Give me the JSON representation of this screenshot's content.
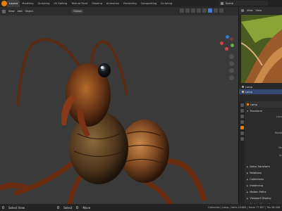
{
  "topbar": {
    "tabs": [
      "Layout",
      "Modeling",
      "Sculpting",
      "UV Editing",
      "Texture Paint",
      "Shading",
      "Animation",
      "Rendering",
      "Compositing",
      "Scripting"
    ],
    "active_tab": "Layout",
    "scene_label": "Scene"
  },
  "viewport_header": {
    "menu": [
      "View",
      "Add",
      "Object"
    ],
    "orientation_dropdown": "Global"
  },
  "right_panel": {
    "image_header": [
      "View",
      "View"
    ],
    "outliner_rows": [
      "Lamp",
      "Lamp"
    ],
    "properties": {
      "object_name": "Lamp",
      "transform_label": "Transform",
      "location_label": "Loca",
      "rotation_label": "Rotati",
      "mode_label": "Mo",
      "scale_label": "Sc",
      "delta_label": "Delta Transform",
      "sections": [
        "Relations",
        "Collections",
        "Instancing",
        "Motion Paths",
        "Viewport Display",
        "Custom Properties"
      ]
    }
  },
  "statusbar": {
    "left": [
      "Select View",
      "Select",
      "Move"
    ],
    "right": "Collection | Lamp | Verts 24,685 | Faces 77,857 | Tris 58,548"
  },
  "colors": {
    "accent": "#e87d0d",
    "selection": "#334b72",
    "viewport_bg": "#3a3a3a"
  }
}
